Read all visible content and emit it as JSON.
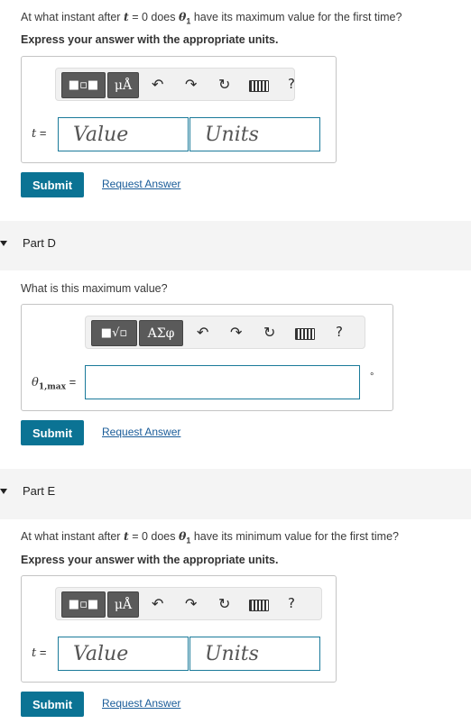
{
  "part_c": {
    "question": "At what instant after t = 0 does θ₁ have its maximum value for the first time?",
    "instruction": "Express your answer with the appropriate units.",
    "var_label": "t =",
    "value_placeholder": "Value",
    "units_placeholder": "Units",
    "submit_label": "Submit",
    "request_label": "Request Answer"
  },
  "part_d": {
    "title": "Part D",
    "question": "What is this maximum value?",
    "var_label": "θ1,max =",
    "unit_suffix": "°",
    "submit_label": "Submit",
    "request_label": "Request Answer"
  },
  "part_e": {
    "title": "Part E",
    "question": "At what instant after t = 0 does θ₁ have its minimum value for the first time?",
    "instruction": "Express your answer with the appropriate units.",
    "var_label": "t =",
    "value_placeholder": "Value",
    "units_placeholder": "Units",
    "submit_label": "Submit",
    "request_label": "Request Answer"
  },
  "toolbar": {
    "templates_label": "▪▫",
    "units_symbol": "μÅ",
    "greek_label": "ΑΣφ",
    "sqrt_label": "√▫",
    "help_label": "?"
  }
}
